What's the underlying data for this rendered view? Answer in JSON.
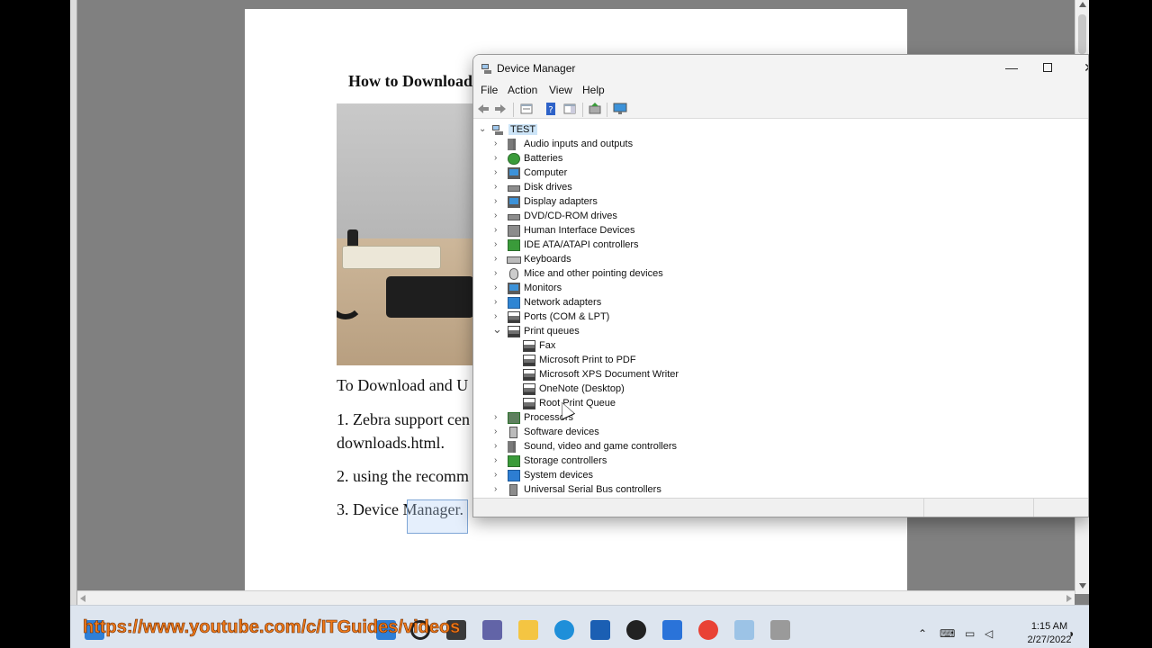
{
  "document": {
    "title": "How to Download",
    "para1": "To Download and U",
    "para2a": "1. Zebra support cen",
    "para2b": "downloads.html.",
    "para3": "2. using the recomm",
    "para4": "3. Device Manager."
  },
  "window": {
    "title": "Device Manager",
    "minimize_label": "—",
    "close_label": "✕",
    "menu": [
      "File",
      "Action",
      "View",
      "Help"
    ]
  },
  "tree": {
    "root": "TEST",
    "items": [
      {
        "label": "Audio inputs and outputs",
        "icon": "speaker-icon",
        "expanded": false
      },
      {
        "label": "Batteries",
        "icon": "battery-icon",
        "expanded": false
      },
      {
        "label": "Computer",
        "icon": "computer-icon",
        "expanded": false
      },
      {
        "label": "Disk drives",
        "icon": "disk-drive-icon",
        "expanded": false
      },
      {
        "label": "Display adapters",
        "icon": "display-adapter-icon",
        "expanded": false
      },
      {
        "label": "DVD/CD-ROM drives",
        "icon": "dvd-drive-icon",
        "expanded": false
      },
      {
        "label": "Human Interface Devices",
        "icon": "hid-icon",
        "expanded": false
      },
      {
        "label": "IDE ATA/ATAPI controllers",
        "icon": "ide-controller-icon",
        "expanded": false
      },
      {
        "label": "Keyboards",
        "icon": "keyboard-icon",
        "expanded": false
      },
      {
        "label": "Mice and other pointing devices",
        "icon": "mouse-icon",
        "expanded": false
      },
      {
        "label": "Monitors",
        "icon": "monitor-icon",
        "expanded": false
      },
      {
        "label": "Network adapters",
        "icon": "network-adapter-icon",
        "expanded": false
      },
      {
        "label": "Ports (COM & LPT)",
        "icon": "port-icon",
        "expanded": false
      },
      {
        "label": "Print queues",
        "icon": "printer-icon",
        "expanded": true
      },
      {
        "label": "Processors",
        "icon": "processor-icon",
        "expanded": false
      },
      {
        "label": "Software devices",
        "icon": "software-device-icon",
        "expanded": false
      },
      {
        "label": "Sound, video and game controllers",
        "icon": "sound-controller-icon",
        "expanded": false
      },
      {
        "label": "Storage controllers",
        "icon": "storage-controller-icon",
        "expanded": false
      },
      {
        "label": "System devices",
        "icon": "system-device-icon",
        "expanded": false
      },
      {
        "label": "Universal Serial Bus controllers",
        "icon": "usb-icon",
        "expanded": false
      }
    ],
    "print_queue_children": [
      "Fax",
      "Microsoft Print to PDF",
      "Microsoft XPS Document Writer",
      "OneNote (Desktop)",
      "Root Print Queue"
    ]
  },
  "taskbar": {
    "overlay_url": "https://www.youtube.com/c/ITGuides/videos",
    "time": "1:15 AM",
    "date": "2/27/2022"
  },
  "colors": {
    "accent": "#2d7dd2",
    "overlay_text": "#f07a1a",
    "selection": "#cce4f7"
  }
}
